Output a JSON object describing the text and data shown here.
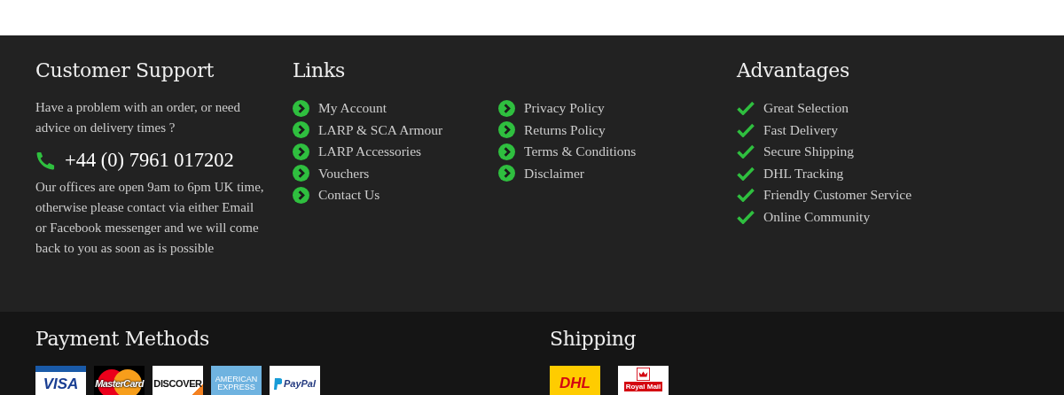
{
  "support": {
    "title": "Customer Support",
    "intro": "Have a problem with an order, or need advice on delivery times ?",
    "phone": "+44 (0) 7961 017202",
    "hours": "Our offices are open 9am to 6pm UK time, otherwise please contact via either Email or Facebook messenger and we will come back to you as soon as is possible"
  },
  "links": {
    "title": "Links",
    "columns": [
      [
        "My Account",
        "LARP & SCA Armour",
        "LARP Accessories",
        "Vouchers",
        "Contact Us"
      ],
      [
        "Privacy Policy",
        "Returns Policy",
        "Terms & Conditions",
        "Disclaimer"
      ]
    ]
  },
  "advantages": {
    "title": "Advantages",
    "items": [
      "Great Selection",
      "Fast Delivery",
      "Secure Shipping",
      "DHL Tracking",
      "Friendly Customer Service",
      "Online Community"
    ]
  },
  "payment": {
    "title": "Payment Methods",
    "logos": [
      {
        "kind": "visa",
        "label": "VISA"
      },
      {
        "kind": "mastercard",
        "label": "MasterCard"
      },
      {
        "kind": "discover",
        "label": "DISCOVER"
      },
      {
        "kind": "amex",
        "label": "AMERICAN EXPRESS"
      },
      {
        "kind": "paypal",
        "label": "PayPal"
      }
    ]
  },
  "shipping": {
    "title": "Shipping",
    "logos": [
      {
        "kind": "dhl",
        "label": "DHL"
      },
      {
        "kind": "royalmail",
        "label": "Royal Mail"
      }
    ]
  }
}
